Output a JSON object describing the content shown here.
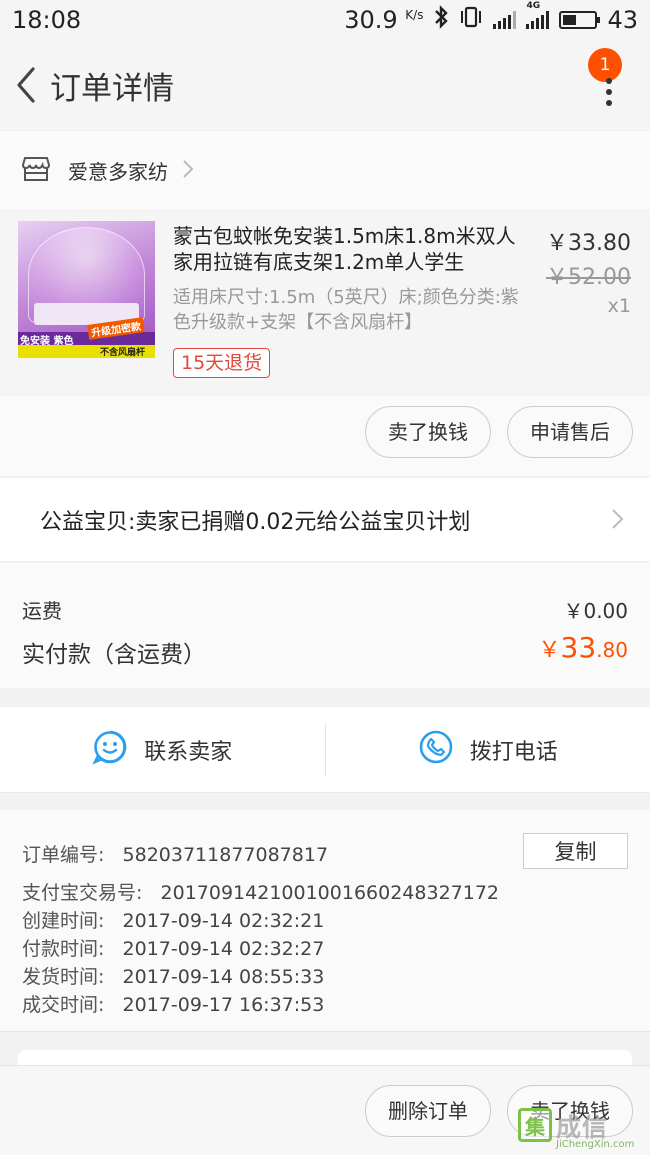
{
  "status_bar": {
    "time": "18:08",
    "net_speed": "30.9",
    "net_unit": "K/s",
    "network_type": "4G",
    "battery": "43",
    "battery_level": 0.43,
    "icons": [
      "bluetooth-icon",
      "vibrate-icon",
      "signal-icon",
      "battery-icon"
    ]
  },
  "nav": {
    "title": "订单详情",
    "badge_count": "1",
    "icons": [
      "back-arrow-icon",
      "more-icon"
    ]
  },
  "shop": {
    "name": "爱意多家纺",
    "icons": [
      "store-icon",
      "chevron-right-icon"
    ]
  },
  "product": {
    "title": "蒙古包蚊帐免安装1.5m床1.8m米双人家用拉链有底支架1.2m单人学生",
    "sku": "适用床尺寸:1.5m（5英尺）床;颜色分类:紫色升级款+支架【不含风扇杆】",
    "refund_tag": "15天退货",
    "price": "￥33.80",
    "original_price": "￥52.00",
    "quantity": "x1",
    "image_text": {
      "badge1": "免安装 紫色",
      "badge2": "升级加密款",
      "badge3": "不含风扇杆"
    }
  },
  "shop_actions": {
    "sell_label": "卖了换钱",
    "after_sale_label": "申请售后"
  },
  "charity": {
    "text": "公益宝贝:卖家已捐赠0.02元给公益宝贝计划"
  },
  "fees": {
    "shipping_label": "运费",
    "shipping_value": "￥0.00",
    "paid_label": "实付款（含运费）",
    "paid_currency": "￥",
    "paid_int": "33",
    "paid_dec": ".80"
  },
  "contact": {
    "seller_label": "联系卖家",
    "phone_label": "拨打电话",
    "icons": [
      "chat-icon",
      "phone-icon"
    ]
  },
  "order_info": {
    "copy_label": "复制",
    "rows": [
      {
        "key": "订单编号:",
        "value": "58203711877087817"
      },
      {
        "key": "支付宝交易号:",
        "value": "2017091421001001660248327172"
      },
      {
        "key": "创建时间:",
        "value": "2017-09-14 02:32:21"
      },
      {
        "key": "付款时间:",
        "value": "2017-09-14 02:32:27"
      },
      {
        "key": "发货时间:",
        "value": "2017-09-14 08:55:33"
      },
      {
        "key": "成交时间:",
        "value": "2017-09-17 16:37:53"
      }
    ]
  },
  "footer": {
    "delete_label": "删除订单",
    "sell_label": "卖了换钱"
  },
  "watermark": {
    "logo": "集",
    "text": "成信",
    "sub": "JiChengXin.com"
  },
  "colors": {
    "accent": "#ff5000",
    "icon_blue": "#2a9ef0",
    "refund_red": "#e04a3a"
  }
}
